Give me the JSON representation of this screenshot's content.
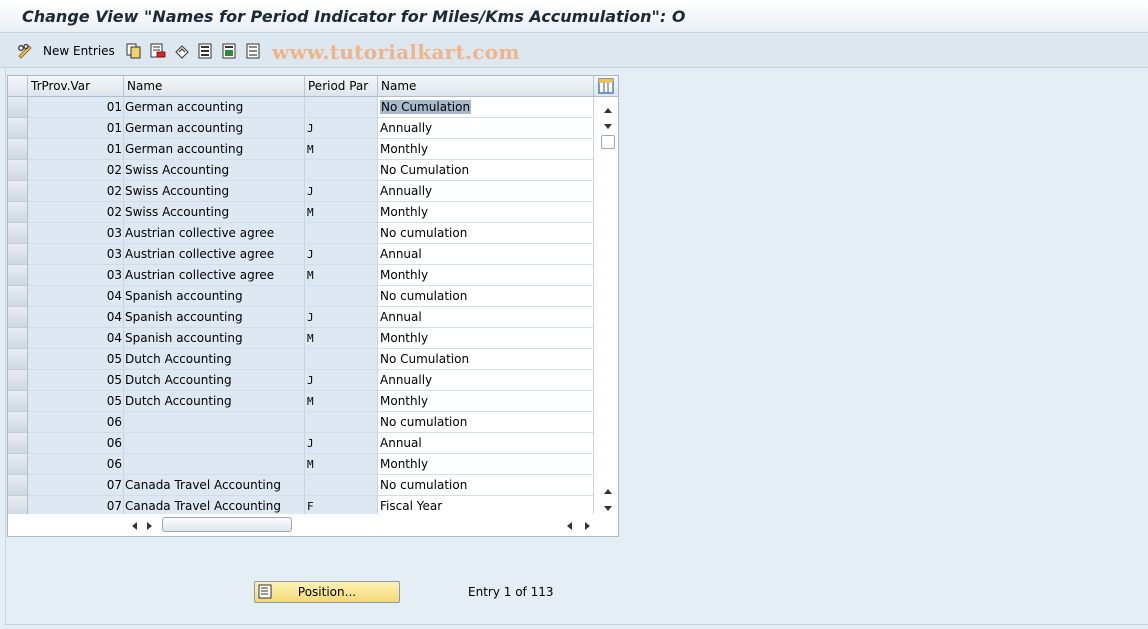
{
  "window": {
    "title": "Change View \"Names for Period Indicator for Miles/Kms Accumulation\": O"
  },
  "toolbar": {
    "new_entries_label": "New Entries",
    "watermark": "www.tutorialkart.com",
    "icons": [
      "glasses-pencil-icon",
      "copy-icon",
      "delete-icon",
      "undo-icon",
      "select-all-icon",
      "select-block-icon",
      "deselect-all-icon"
    ]
  },
  "table": {
    "columns": [
      "TrProv.Var",
      "Name",
      "Period Par",
      "Name"
    ],
    "rows": [
      {
        "var": "01",
        "name": "German accounting",
        "period": "",
        "pname": "No Cumulation"
      },
      {
        "var": "01",
        "name": "German accounting",
        "period": "J",
        "pname": "Annually"
      },
      {
        "var": "01",
        "name": "German accounting",
        "period": "M",
        "pname": "Monthly"
      },
      {
        "var": "02",
        "name": "Swiss Accounting",
        "period": "",
        "pname": "No Cumulation"
      },
      {
        "var": "02",
        "name": "Swiss Accounting",
        "period": "J",
        "pname": "Annually"
      },
      {
        "var": "02",
        "name": "Swiss Accounting",
        "period": "M",
        "pname": "Monthly"
      },
      {
        "var": "03",
        "name": "Austrian collective agree",
        "period": "",
        "pname": "No cumulation"
      },
      {
        "var": "03",
        "name": "Austrian collective agree",
        "period": "J",
        "pname": "Annual"
      },
      {
        "var": "03",
        "name": "Austrian collective agree",
        "period": "M",
        "pname": "Monthly"
      },
      {
        "var": "04",
        "name": "Spanish accounting",
        "period": "",
        "pname": "No cumulation"
      },
      {
        "var": "04",
        "name": "Spanish accounting",
        "period": "J",
        "pname": "Annual"
      },
      {
        "var": "04",
        "name": "Spanish accounting",
        "period": "M",
        "pname": "Monthly"
      },
      {
        "var": "05",
        "name": "Dutch Accounting",
        "period": "",
        "pname": "No Cumulation"
      },
      {
        "var": "05",
        "name": "Dutch Accounting",
        "period": "J",
        "pname": "Annually"
      },
      {
        "var": "05",
        "name": "Dutch Accounting",
        "period": "M",
        "pname": "Monthly"
      },
      {
        "var": "06",
        "name": "",
        "period": "",
        "pname": "No cumulation"
      },
      {
        "var": "06",
        "name": "",
        "period": "J",
        "pname": "Annual"
      },
      {
        "var": "06",
        "name": "",
        "period": "M",
        "pname": "Monthly"
      },
      {
        "var": "07",
        "name": "Canada Travel Accounting",
        "period": "",
        "pname": "No cumulation"
      },
      {
        "var": "07",
        "name": "Canada Travel Accounting",
        "period": "F",
        "pname": "Fiscal Year"
      }
    ]
  },
  "footer": {
    "position_button_label": "Position...",
    "entry_text": "Entry 1 of 113"
  }
}
